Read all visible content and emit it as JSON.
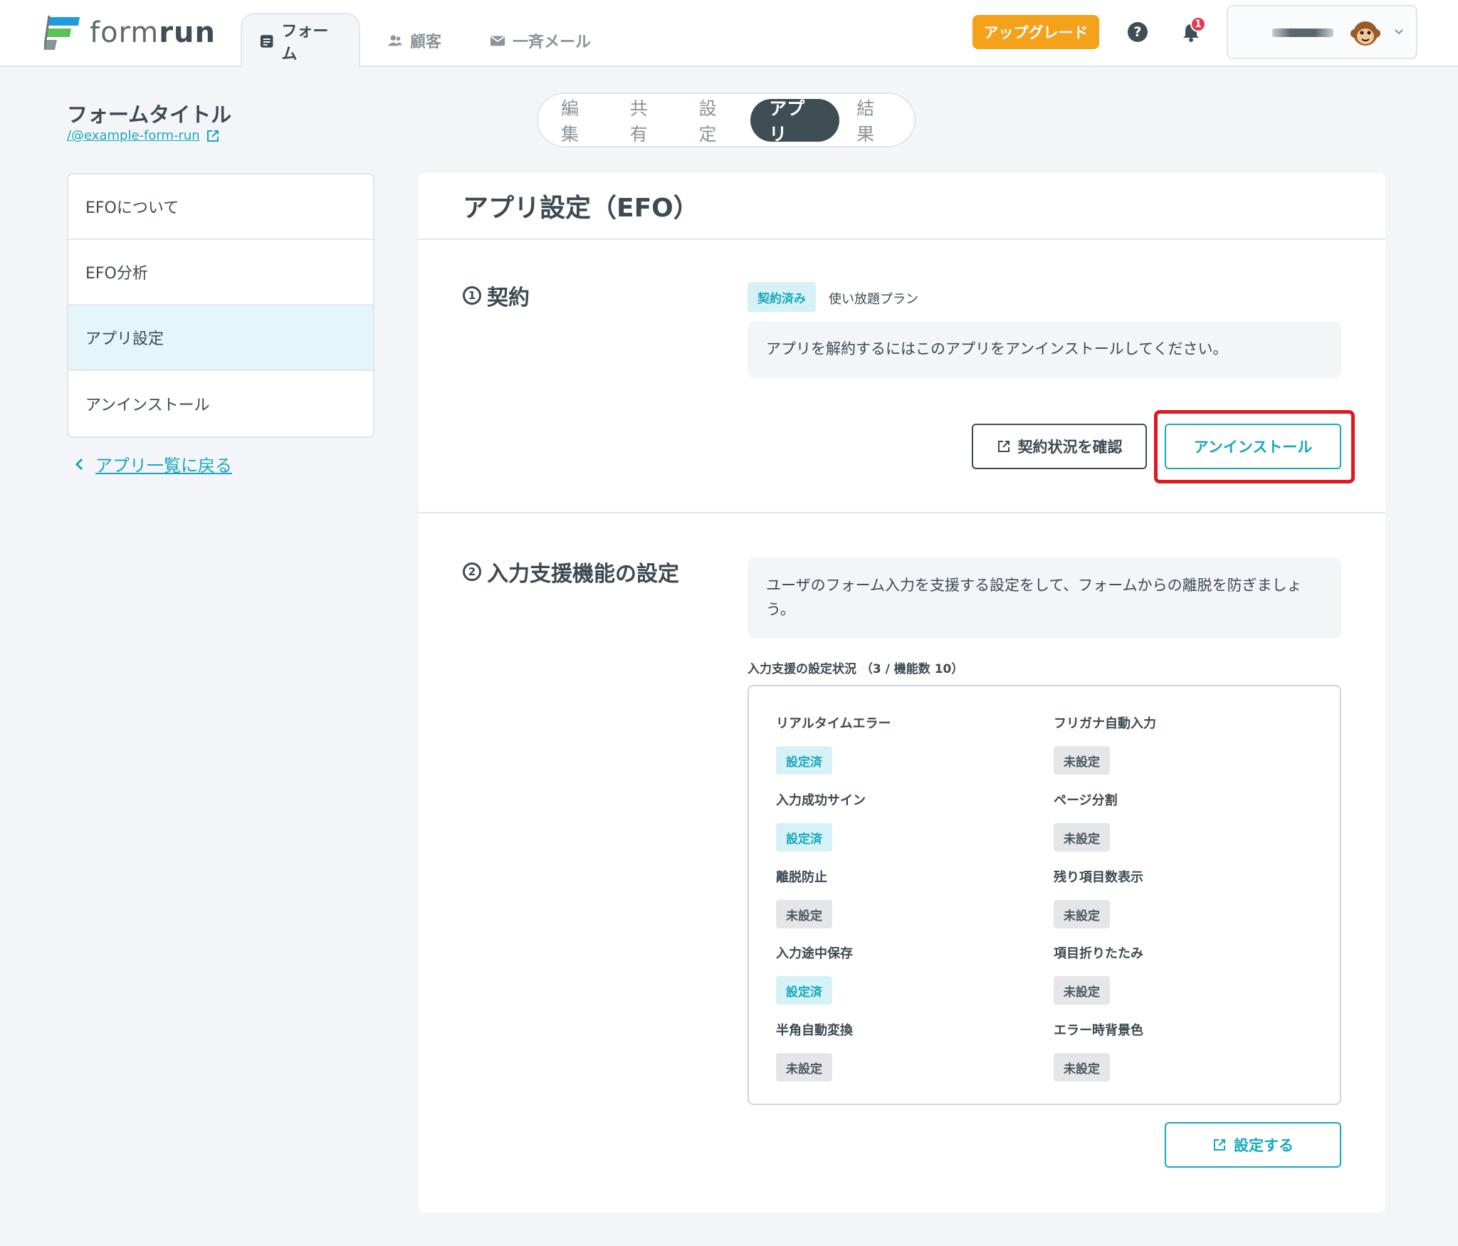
{
  "app": {
    "logo_text_light": "form",
    "logo_text_bold": "run"
  },
  "nav": {
    "tabs": [
      {
        "label": "フォーム",
        "icon": "document-icon",
        "active": true
      },
      {
        "label": "顧客",
        "icon": "users-icon",
        "active": false
      },
      {
        "label": "一斉メール",
        "icon": "mail-icon",
        "active": false
      }
    ],
    "upgrade_label": "アップグレード",
    "help_label": "?",
    "notification_count": "1"
  },
  "form": {
    "title": "フォームタイトル",
    "link": "/@example-form-run"
  },
  "segments": [
    {
      "label": "編集",
      "active": false
    },
    {
      "label": "共有",
      "active": false
    },
    {
      "label": "設定",
      "active": false
    },
    {
      "label": "アプリ",
      "active": true
    },
    {
      "label": "結果",
      "active": false
    }
  ],
  "sidebar": {
    "items": [
      {
        "label": "EFOについて",
        "active": false
      },
      {
        "label": "EFO分析",
        "active": false
      },
      {
        "label": "アプリ設定",
        "active": true
      },
      {
        "label": "アンインストール",
        "active": false
      }
    ],
    "back_label": "アプリ一覧に戻る"
  },
  "main": {
    "title": "アプリ設定（EFO）",
    "contract": {
      "number": "1",
      "heading": "契約",
      "status_badge": "契約済み",
      "plan": "使い放題プラン",
      "note": "アプリを解約するにはこのアプリをアンインストールしてください。",
      "check_button": "契約状況を確認",
      "uninstall_button": "アンインストール"
    },
    "assist": {
      "number": "2",
      "heading": "入力支援機能の設定",
      "note": "ユーザのフォーム入力を支援する設定をして、フォームからの離脱を防ぎましょう。",
      "status_caption": "入力支援の設定状況 （3 / 機能数 10）",
      "features": [
        {
          "name": "リアルタイムエラー",
          "status": "設定済",
          "enabled": true
        },
        {
          "name": "フリガナ自動入力",
          "status": "未設定",
          "enabled": false
        },
        {
          "name": "入力成功サイン",
          "status": "設定済",
          "enabled": true
        },
        {
          "name": "ページ分割",
          "status": "未設定",
          "enabled": false
        },
        {
          "name": "離脱防止",
          "status": "未設定",
          "enabled": false
        },
        {
          "name": "残り項目数表示",
          "status": "未設定",
          "enabled": false
        },
        {
          "name": "入力途中保存",
          "status": "設定済",
          "enabled": true
        },
        {
          "name": "項目折りたたみ",
          "status": "未設定",
          "enabled": false
        },
        {
          "name": "半角自動変換",
          "status": "未設定",
          "enabled": false
        },
        {
          "name": "エラー時背景色",
          "status": "未設定",
          "enabled": false
        }
      ],
      "configure_button": "設定する"
    }
  },
  "colors": {
    "accent": "#17a8bd",
    "upgrade": "#f5a11a",
    "highlight": "#e3151e",
    "dark": "#3f4d55"
  }
}
